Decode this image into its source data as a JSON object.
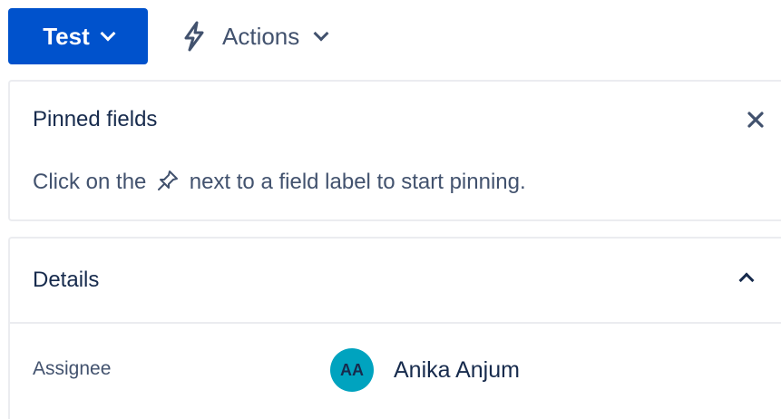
{
  "toolbar": {
    "status_label": "Test",
    "actions_label": "Actions"
  },
  "pinned_fields": {
    "title": "Pinned fields",
    "hint_before": "Click on the",
    "hint_after": "next to a field label to start pinning."
  },
  "details": {
    "title": "Details",
    "fields": [
      {
        "label": "Assignee",
        "avatar_initials": "AA",
        "value": "Anika Anjum"
      }
    ]
  },
  "colors": {
    "primary": "#0052cc",
    "avatar_bg": "#00a3bf",
    "border": "#ebecf0",
    "text": "#172b4d",
    "subtle_text": "#42526e"
  },
  "icons": {
    "actions": "lightning-bolt-icon",
    "close": "close-icon",
    "pin": "pin-icon",
    "collapse": "chevron-up-icon",
    "dropdown": "chevron-down-icon"
  }
}
